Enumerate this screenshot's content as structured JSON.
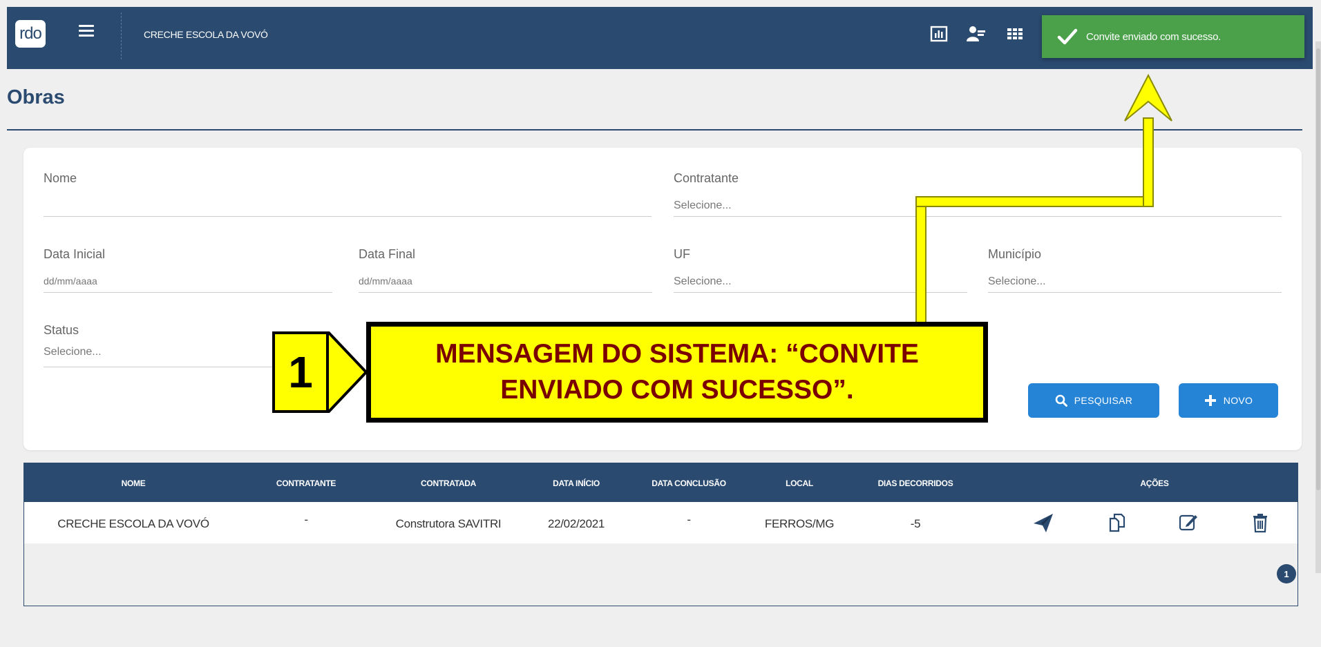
{
  "header": {
    "logo_text": "rdo",
    "title": "CRECHE ESCOLA DA VOVÓ",
    "icons": [
      "chart-icon",
      "user-admin-icon",
      "apps-grid-icon"
    ]
  },
  "toast": {
    "message": "Convite enviado com sucesso."
  },
  "page": {
    "title": "Obras"
  },
  "filters": {
    "nome": {
      "label": "Nome",
      "value": ""
    },
    "contratante": {
      "label": "Contratante",
      "value": "Selecione..."
    },
    "data_inicial": {
      "label": "Data Inicial",
      "placeholder": "dd/mm/aaaa"
    },
    "data_final": {
      "label": "Data Final",
      "placeholder": "dd/mm/aaaa"
    },
    "uf": {
      "label": "UF",
      "value": "Selecione..."
    },
    "municipio": {
      "label": "Município",
      "value": "Selecione..."
    },
    "status": {
      "label": "Status",
      "value": "Selecione..."
    },
    "search_label": "PESQUISAR",
    "new_label": "NOVO"
  },
  "annotation": {
    "number": "1",
    "line1": "MENSAGEM DO SISTEMA: “CONVITE",
    "line2": "ENVIADO COM SUCESSO”."
  },
  "table": {
    "columns": [
      "NOME",
      "CONTRATANTE",
      "CONTRATADA",
      "DATA INÍCIO",
      "DATA CONCLUSÃO",
      "LOCAL",
      "DIAS DECORRIDOS",
      "AÇÕES"
    ],
    "rows": [
      {
        "nome": "CRECHE ESCOLA DA VOVÓ",
        "contratante": "-",
        "contratada": "Construtora SAVITRI",
        "data_inicio": "22/02/2021",
        "data_conclusao": "-",
        "local": "FERROS/MG",
        "dias": "-5"
      }
    ],
    "actions": [
      "send-invite-icon",
      "copy-icon",
      "edit-icon",
      "delete-icon"
    ],
    "page": "1"
  },
  "colors": {
    "header": "#2a4a6f",
    "toast": "#4aa14a",
    "button": "#2584d6",
    "annotation": "#ffff00"
  }
}
